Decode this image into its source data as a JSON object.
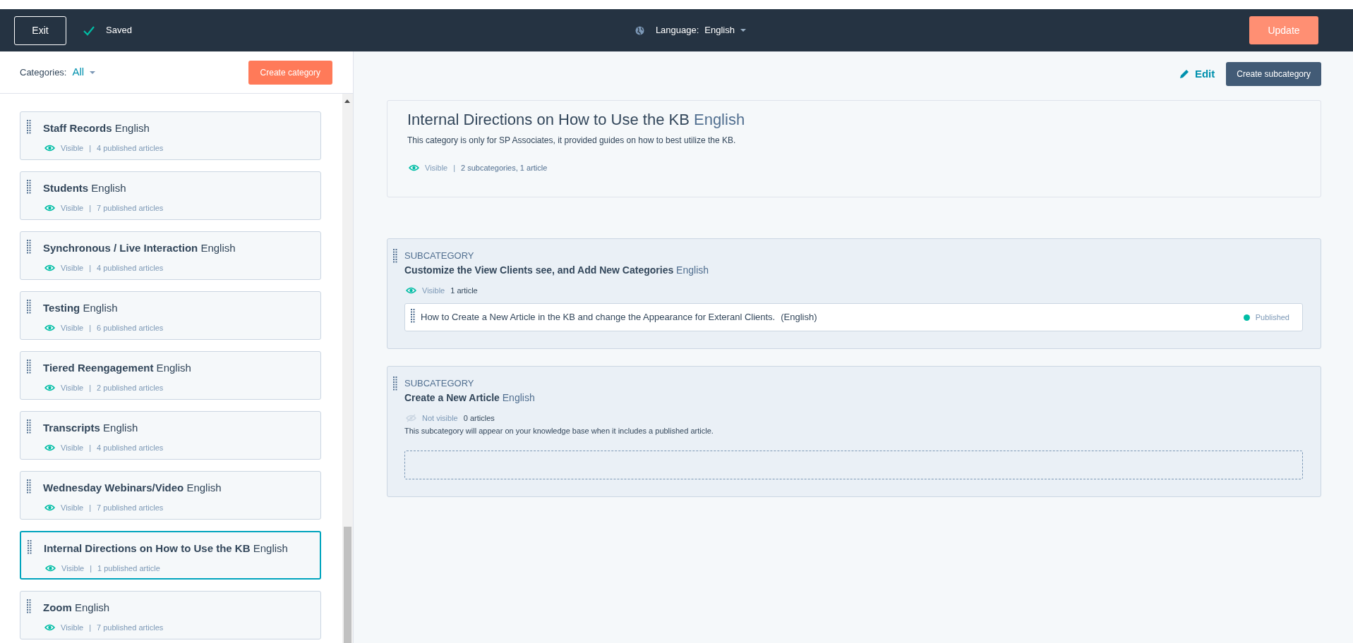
{
  "top_bar": {
    "exit_button": "Exit",
    "saved": "Saved",
    "language_label": "Language:",
    "language_value": "English",
    "update_button": "Update"
  },
  "sidebar": {
    "filter_label": "Categories:",
    "filter_value": "All",
    "create_button": "Create category",
    "categories": [
      {
        "name": "Staff Records",
        "language": "English",
        "visibility": "Visible",
        "visible": true,
        "separator": "|",
        "count": "4 published articles",
        "selected": false
      },
      {
        "name": "Students",
        "language": "English",
        "visibility": "Visible",
        "visible": true,
        "separator": "|",
        "count": "7 published articles",
        "selected": false
      },
      {
        "name": "Synchronous / Live Interaction",
        "language": "English",
        "visibility": "Visible",
        "visible": true,
        "separator": "|",
        "count": "4 published articles",
        "selected": false
      },
      {
        "name": "Testing",
        "language": "English",
        "visibility": "Visible",
        "visible": true,
        "separator": "|",
        "count": "6 published articles",
        "selected": false
      },
      {
        "name": "Tiered Reengagement",
        "language": "English",
        "visibility": "Visible",
        "visible": true,
        "separator": "|",
        "count": "2 published articles",
        "selected": false
      },
      {
        "name": "Transcripts",
        "language": "English",
        "visibility": "Visible",
        "visible": true,
        "separator": "|",
        "count": "4 published articles",
        "selected": false
      },
      {
        "name": "Wednesday Webinars/Video",
        "language": "English",
        "visibility": "Visible",
        "visible": true,
        "separator": "|",
        "count": "7 published articles",
        "selected": false
      },
      {
        "name": "Internal Directions on How to Use the KB",
        "language": "English",
        "visibility": "Visible",
        "visible": true,
        "separator": "|",
        "count": "1 published article",
        "selected": true
      },
      {
        "name": "Zoom",
        "language": "English",
        "visibility": "Visible",
        "visible": true,
        "separator": "|",
        "count": "7 published articles",
        "selected": false
      }
    ]
  },
  "main": {
    "edit_link": "Edit",
    "create_subcategory_button": "Create subcategory",
    "category": {
      "title": "Internal Directions on How to Use the KB",
      "language": "English",
      "description": "This category is only for SP Associates, it provided guides on how to best utilize the KB.",
      "visibility": "Visible",
      "visible": true,
      "separator": "|",
      "count": "2 subcategories, 1 article"
    },
    "subcategories": [
      {
        "label": "SUBCATEGORY",
        "title": "Customize the View Clients see, and Add New Categories",
        "language": "English",
        "visibility": "Visible",
        "visible": true,
        "count": "1 article",
        "articles": [
          {
            "title": "How to Create a New Article in the KB and change the Appearance for Exteranl Clients.",
            "language": "(English)",
            "status": "Published",
            "color": "#00bda5"
          }
        ]
      },
      {
        "label": "SUBCATEGORY",
        "title": "Create a New Article",
        "language": "English",
        "visibility": "Not visible",
        "visible": false,
        "count": "0 articles",
        "note": "This subcategory will appear on your knowledge base when it includes a published article."
      }
    ]
  }
}
